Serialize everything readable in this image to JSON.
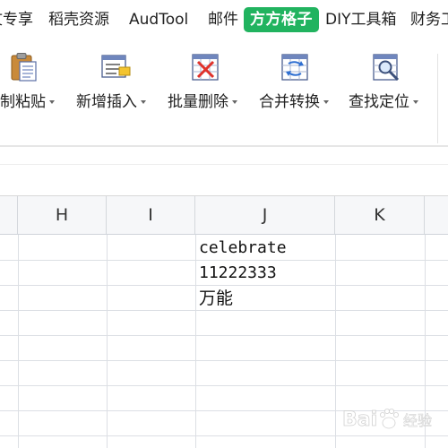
{
  "menu": {
    "tabs": [
      {
        "label": "文专享"
      },
      {
        "label": "稻壳资源"
      },
      {
        "label": "AudTool"
      },
      {
        "label": "邮件"
      },
      {
        "label": "方方格子",
        "active": true
      },
      {
        "label": "DIY工具箱"
      },
      {
        "label": "财务工"
      }
    ],
    "active_color": "#21b35f"
  },
  "ribbon": {
    "buttons": [
      {
        "label": "复制粘贴",
        "icon": "paste-icon"
      },
      {
        "label": "新增插入",
        "icon": "insert-table-icon"
      },
      {
        "label": "批量删除",
        "icon": "delete-table-icon"
      },
      {
        "label": "合并转换",
        "icon": "merge-convert-icon"
      },
      {
        "label": "查找定位",
        "icon": "find-locate-icon"
      }
    ]
  },
  "sheet": {
    "columns": [
      "H",
      "I",
      "J",
      "K"
    ],
    "cells": [
      {
        "col": "J",
        "row": 1,
        "value": "celebrate"
      },
      {
        "col": "J",
        "row": 2,
        "value": "11222333"
      },
      {
        "col": "J",
        "row": 3,
        "value": "万能"
      }
    ]
  },
  "watermark": {
    "text": "Bai",
    "suffix": "经验"
  }
}
